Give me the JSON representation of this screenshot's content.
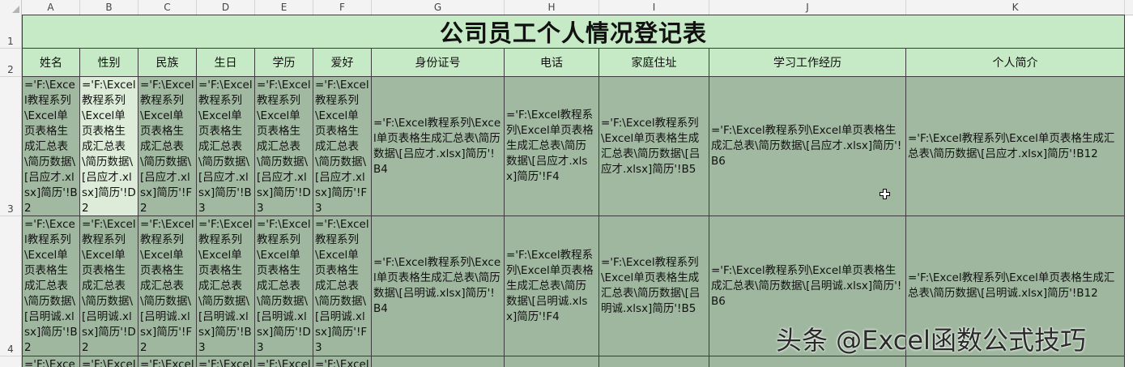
{
  "columns": [
    "A",
    "B",
    "C",
    "D",
    "E",
    "F",
    "G",
    "H",
    "I",
    "J",
    "K"
  ],
  "rows": [
    "1",
    "2",
    "3",
    "4"
  ],
  "title": "公司员工个人情况登记表",
  "headers": [
    "姓名",
    "性别",
    "民族",
    "生日",
    "学历",
    "爱好",
    "身份证号",
    "电话",
    "家庭住址",
    "学习工作经历",
    "个人简介"
  ],
  "row3": [
    "='F:\\Excel教程系列\\Excel单页表格生成汇总表\\简历数据\\[吕应才.xlsx]简历'!B2",
    "='F:\\Excel教程系列\\Excel单页表格生成汇总表\\简历数据\\[吕应才.xlsx]简历'!D2",
    "='F:\\Excel教程系列\\Excel单页表格生成汇总表\\简历数据\\[吕应才.xlsx]简历'!F2",
    "='F:\\Excel教程系列\\Excel单页表格生成汇总表\\简历数据\\[吕应才.xlsx]简历'!B3",
    "='F:\\Excel教程系列\\Excel单页表格生成汇总表\\简历数据\\[吕应才.xlsx]简历'!D3",
    "='F:\\Excel教程系列\\Excel单页表格生成汇总表\\简历数据\\[吕应才.xlsx]简历'!F3",
    "='F:\\Excel教程系列\\Excel单页表格生成汇总表\\简历数据\\[吕应才.xlsx]简历'!B4",
    "='F:\\Excel教程系列\\Excel单页表格生成汇总表\\简历数据\\[吕应才.xlsx]简历'!F4",
    "='F:\\Excel教程系列\\Excel单页表格生成汇总表\\简历数据\\[吕应才.xlsx]简历'!B5",
    "='F:\\Excel教程系列\\Excel单页表格生成汇总表\\简历数据\\[吕应才.xlsx]简历'!B6",
    "='F:\\Excel教程系列\\Excel单页表格生成汇总表\\简历数据\\[吕应才.xlsx]简历'!B12"
  ],
  "row4": [
    "='F:\\Excel教程系列\\Excel单页表格生成汇总表\\简历数据\\[吕明诚.xlsx]简历'!B2",
    "='F:\\Excel教程系列\\Excel单页表格生成汇总表\\简历数据\\[吕明诚.xlsx]简历'!D2",
    "='F:\\Excel教程系列\\Excel单页表格生成汇总表\\简历数据\\[吕明诚.xlsx]简历'!F2",
    "='F:\\Excel教程系列\\Excel单页表格生成汇总表\\简历数据\\[吕明诚.xlsx]简历'!B3",
    "='F:\\Excel教程系列\\Excel单页表格生成汇总表\\简历数据\\[吕明诚.xlsx]简历'!D3",
    "='F:\\Excel教程系列\\Excel单页表格生成汇总表\\简历数据\\[吕明诚.xlsx]简历'!F3",
    "='F:\\Excel教程系列\\Excel单页表格生成汇总表\\简历数据\\[吕明诚.xlsx]简历'!B4",
    "='F:\\Excel教程系列\\Excel单页表格生成汇总表\\简历数据\\[吕明诚.xlsx]简历'!F4",
    "='F:\\Excel教程系列\\Excel单页表格生成汇总表\\简历数据\\[吕明诚.xlsx]简历'!B5",
    "='F:\\Excel教程系列\\Excel单页表格生成汇总表\\简历数据\\[吕明诚.xlsx]简历'!B6",
    "='F:\\Excel教程系列\\Excel单页表格生成汇总表\\简历数据\\[吕明诚.xlsx]简历'!B12"
  ],
  "row5_partial": "='F:\\Excel",
  "watermark": "头条 @Excel函数公式技巧",
  "colors": {
    "header_green": "#c6e9c6",
    "cell_green": "#9fb79f"
  }
}
